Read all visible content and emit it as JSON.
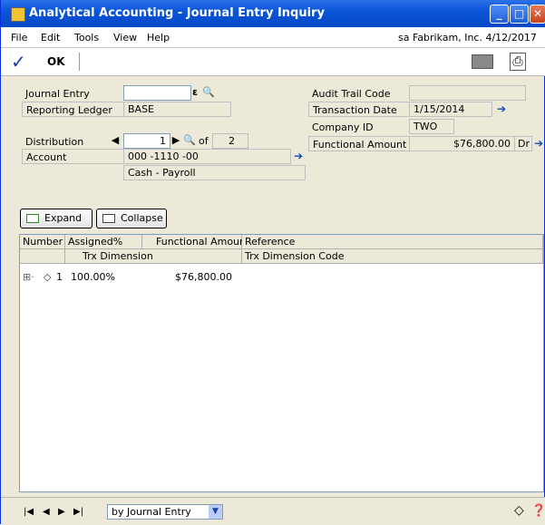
{
  "window": {
    "title": "Analytical Accounting - Journal Entry Inquiry",
    "controls": {
      "minimize": "_",
      "maximize": "□",
      "close": "✕"
    }
  },
  "menu": {
    "items": [
      "File",
      "Edit",
      "Tools",
      "View",
      "Help"
    ],
    "company_info": "sa  Fabrikam, Inc.  4/12/2017"
  },
  "toolbar": {
    "ok_label": "OK"
  },
  "form": {
    "journal_entry_label": "Journal Entry",
    "journal_entry_value": "",
    "reporting_ledger_label": "Reporting Ledger",
    "reporting_ledger_value": "BASE",
    "distribution_label": "Distribution",
    "distribution_value": "1",
    "distribution_of": "of",
    "distribution_total": "2",
    "account_label": "Account",
    "account_value": "000 -1110 -00",
    "account_description": "Cash - Payroll",
    "audit_trail_label": "Audit Trail Code",
    "audit_trail_value": "",
    "transaction_date_label": "Transaction Date",
    "transaction_date_value": "1/15/2014",
    "company_id_label": "Company ID",
    "company_id_value": "TWO",
    "functional_amount_label": "Functional Amount",
    "functional_amount_value": "$76,800.00",
    "functional_amount_type": "Dr"
  },
  "buttons": {
    "expand": "Expand",
    "collapse": "Collapse"
  },
  "grid": {
    "headers_row1": [
      "Number",
      "Assigned%",
      "Functional Amount",
      "Reference"
    ],
    "headers_row2": [
      "Trx Dimension",
      "Trx Dimension Code"
    ],
    "rows": [
      {
        "number": "1",
        "assigned": "100.00%",
        "amount": "$76,800.00",
        "reference": ""
      }
    ]
  },
  "status": {
    "sort_by": "by Journal Entry"
  }
}
